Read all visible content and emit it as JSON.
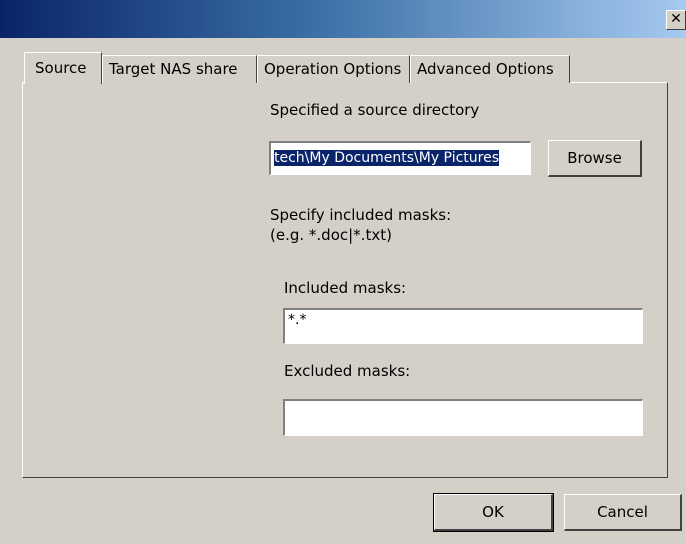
{
  "window": {
    "close_glyph": "✕"
  },
  "tabs": [
    {
      "label": "Source",
      "active": true
    },
    {
      "label": "Target NAS share",
      "active": false
    },
    {
      "label": "Operation Options",
      "active": false
    },
    {
      "label": "Advanced Options",
      "active": false
    }
  ],
  "source": {
    "heading": "Specified a source directory",
    "directory_value": "tech\\My Documents\\My Pictures",
    "browse_label": "Browse",
    "mask_hint_line1": "Specify included masks:",
    "mask_hint_line2": "(e.g. *.doc|*.txt)",
    "included_label": "Included masks:",
    "included_value": "*.*",
    "excluded_label": "Excluded masks:",
    "excluded_value": ""
  },
  "footer": {
    "ok_label": "OK",
    "cancel_label": "Cancel"
  }
}
